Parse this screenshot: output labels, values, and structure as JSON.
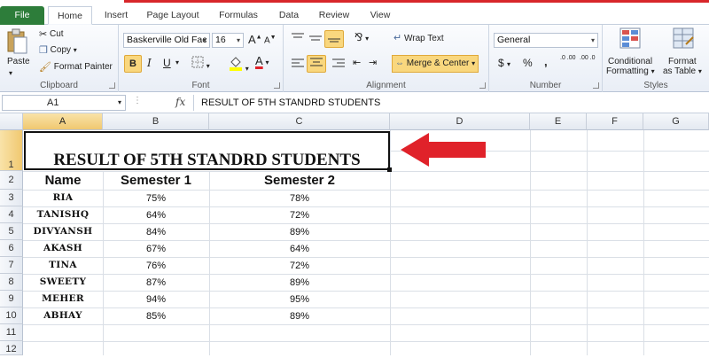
{
  "ribbon_tabs": [
    "File",
    "Home",
    "Insert",
    "Page Layout",
    "Formulas",
    "Data",
    "Review",
    "View"
  ],
  "clipboard": {
    "paste": "Paste",
    "cut": "Cut",
    "copy": "Copy",
    "format_painter": "Format Painter",
    "label": "Clipboard"
  },
  "font": {
    "name": "Baskerville Old Fac",
    "size": "16",
    "label": "Font",
    "bold": "B",
    "italic": "I",
    "underline": "U",
    "grow": "A",
    "shrink": "A",
    "color": "A"
  },
  "alignment": {
    "wrap": "Wrap Text",
    "merge": "Merge & Center",
    "label": "Alignment"
  },
  "number": {
    "format": "General",
    "label": "Number",
    "currency": "$",
    "percent": "%",
    "comma": ",",
    "inc_dec": ".0 .00",
    "dec_dec": ".00 .0"
  },
  "styles": {
    "conditional": "Conditional",
    "formatting": "Formatting",
    "format": "Format",
    "as_table": "as Table",
    "label": "Styles"
  },
  "formula_bar": {
    "name_box": "A1",
    "fx": "fx",
    "content": "RESULT OF 5TH STANDRD STUDENTS"
  },
  "columns": [
    "A",
    "B",
    "C",
    "D",
    "E",
    "F",
    "G"
  ],
  "rows": [
    "1",
    "2",
    "3",
    "4",
    "5",
    "6",
    "7",
    "8",
    "9",
    "10",
    "11",
    "12"
  ],
  "sheet": {
    "title": "RESULT OF 5TH STANDRD STUDENTS",
    "headers": [
      "Name",
      "Semester 1",
      "Semester 2"
    ],
    "data": [
      [
        "RIA",
        "75%",
        "78%"
      ],
      [
        "TANISHQ",
        "64%",
        "72%"
      ],
      [
        "DIVYANSH",
        "84%",
        "89%"
      ],
      [
        "AKASH",
        "67%",
        "64%"
      ],
      [
        "TINA",
        "76%",
        "72%"
      ],
      [
        "SWEETY",
        "87%",
        "89%"
      ],
      [
        "MEHER",
        "94%",
        "95%"
      ],
      [
        "ABHAY",
        "85%",
        "89%"
      ]
    ]
  },
  "colors": {
    "accent": "#2d7d3a",
    "arrow": "#e0222a",
    "selection": "#f0c870"
  }
}
